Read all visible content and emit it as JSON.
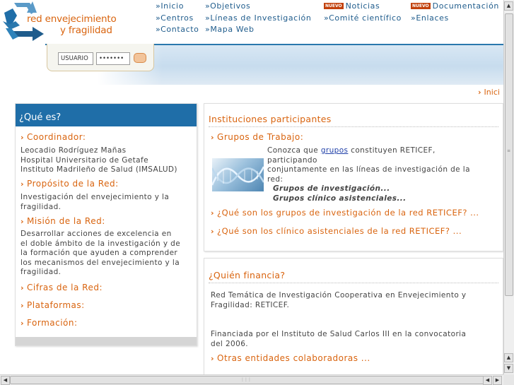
{
  "header": {
    "logo_line1": "red envejecimiento",
    "logo_line2": "y fragilidad",
    "new_badge": "NUEVO",
    "nav": {
      "inicio": "»Inicio",
      "centros": "»Centros",
      "contacto": "»Contacto",
      "objetivos": "»Objetivos",
      "lineas": "»Líneas de Investigación",
      "mapa": "»Mapa Web",
      "noticias": "Noticias",
      "comite": "»Comité científico",
      "documentacion": "Documentación",
      "enlaces": "»Enlaces"
    }
  },
  "login": {
    "user_value": "USUARIO",
    "password_value": "•••••••"
  },
  "breadcrumb": "Inici",
  "left_panel": {
    "title": "¿Qué es?",
    "coordinador": {
      "title": "Coordinador:",
      "lines": [
        "Leocadio Rodríguez Mañas",
        "Hospital Universitario de Getafe",
        "Instituto Madrileño de Salud (IMSALUD)"
      ]
    },
    "proposito": {
      "title": "Propósito de la Red:",
      "lines": [
        "Investigación del envejecimiento y la",
        "fragilidad."
      ]
    },
    "mision": {
      "title": "Misión de la Red:",
      "lines": [
        "Desarrollar acciones de excelencia en",
        "el doble ámbito de la investigación y de",
        "la formación que ayuden a comprender",
        "los mecanismos del envejecimiento y la",
        "fragilidad."
      ]
    },
    "cifras": "Cifras de la Red:",
    "plataformas": "Plataformas:",
    "formacion": "Formación:"
  },
  "instituciones": {
    "title": "Instituciones participantes",
    "grupos_title": "Grupos de Trabajo:",
    "intro_before": "Conozca que ",
    "intro_link": "grupos",
    "intro_after": " constituyen RETICEF,",
    "line2": "participando",
    "line3": "conjuntamente en las líneas de investigación de la",
    "line4": "red:",
    "grupos_inv": "Grupos de investigación...",
    "grupos_clin": "Grupos clínico asistenciales...",
    "faq1": "¿Qué son los grupos de investigación de la red RETICEF? ...",
    "faq2": "¿Qué son los clínico asistenciales de la red RETICEF? ..."
  },
  "financia": {
    "title": "¿Quién financia?",
    "line1": "Red Temática de Investigación Cooperativa en Envejecimiento y",
    "line2": "Fragilidad: RETICEF.",
    "line3": "Financiada por el Instituto de Salud Carlos III en la convocatoria",
    "line4": "del 2006.",
    "otras": "Otras entidades colaboradoras ..."
  },
  "colors": {
    "accent_orange": "#d9640f",
    "primary_blue": "#1f6ea8",
    "nav_blue": "#1f5c8c"
  },
  "icons": {
    "logo": "recycle-arrows-icon",
    "arrow": "orange-arrow-icon"
  }
}
